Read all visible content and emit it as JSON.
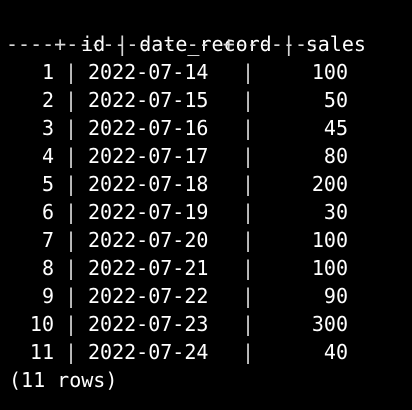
{
  "header": {
    "id": "id",
    "date_record": "date_record",
    "sales": "sales",
    "separator": "|"
  },
  "rule": "----+-------------+-------",
  "rows": [
    {
      "id": "1",
      "date_record": "2022-07-14",
      "sales": "100"
    },
    {
      "id": "2",
      "date_record": "2022-07-15",
      "sales": "50"
    },
    {
      "id": "3",
      "date_record": "2022-07-16",
      "sales": "45"
    },
    {
      "id": "4",
      "date_record": "2022-07-17",
      "sales": "80"
    },
    {
      "id": "5",
      "date_record": "2022-07-18",
      "sales": "200"
    },
    {
      "id": "6",
      "date_record": "2022-07-19",
      "sales": "30"
    },
    {
      "id": "7",
      "date_record": "2022-07-20",
      "sales": "100"
    },
    {
      "id": "8",
      "date_record": "2022-07-21",
      "sales": "100"
    },
    {
      "id": "9",
      "date_record": "2022-07-22",
      "sales": "90"
    },
    {
      "id": "10",
      "date_record": "2022-07-23",
      "sales": "300"
    },
    {
      "id": "11",
      "date_record": "2022-07-24",
      "sales": "40"
    }
  ],
  "footer": "(11 rows)",
  "colors": {
    "background": "#000000",
    "text": "#ffffff"
  }
}
